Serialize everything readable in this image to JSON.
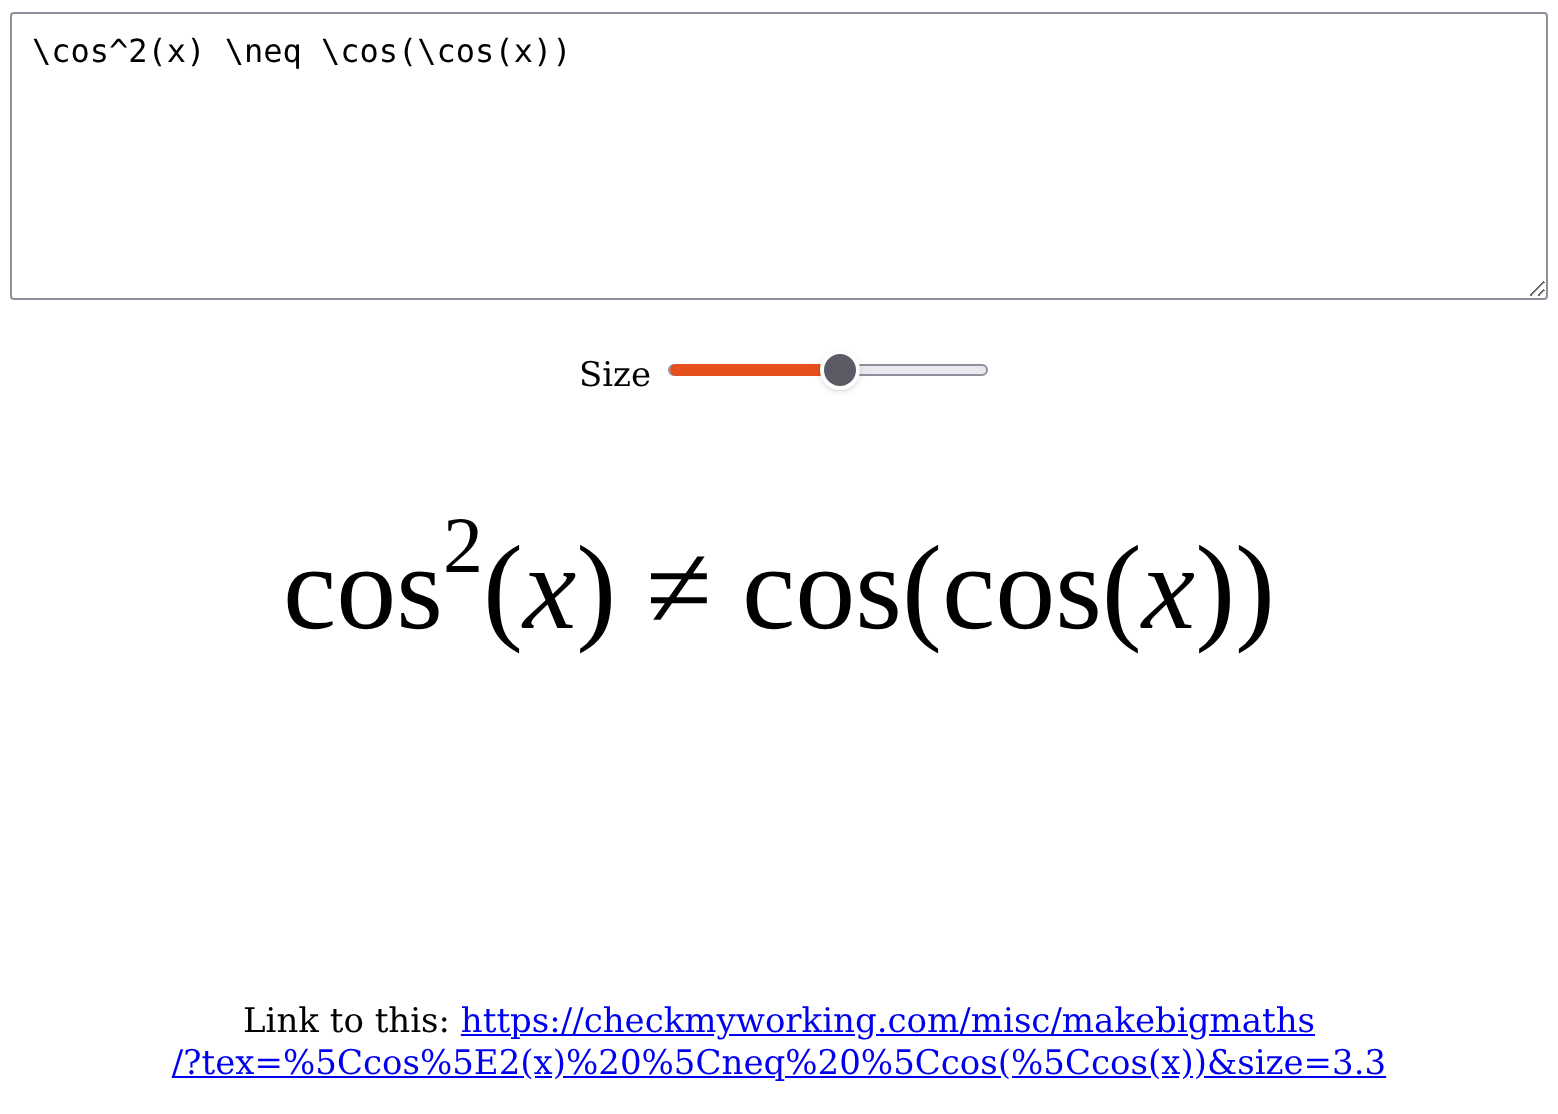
{
  "editor": {
    "value": "\\cos^2(x) \\neq \\cos(\\cos(x))"
  },
  "size_slider": {
    "label": "Size",
    "level": 0.54
  },
  "formula": "cos$^{2}$(*x*) ≠ cos(cos(*x*))",
  "link": {
    "label": "Link to this:",
    "url_lines": [
      "https://checkmyworking.com/misc/makebigmaths",
      "/?tex=%5Ccos%5E2(x)%20%5Cneq%20%5Ccos(%5Ccos(x))&size=3.3"
    ]
  }
}
